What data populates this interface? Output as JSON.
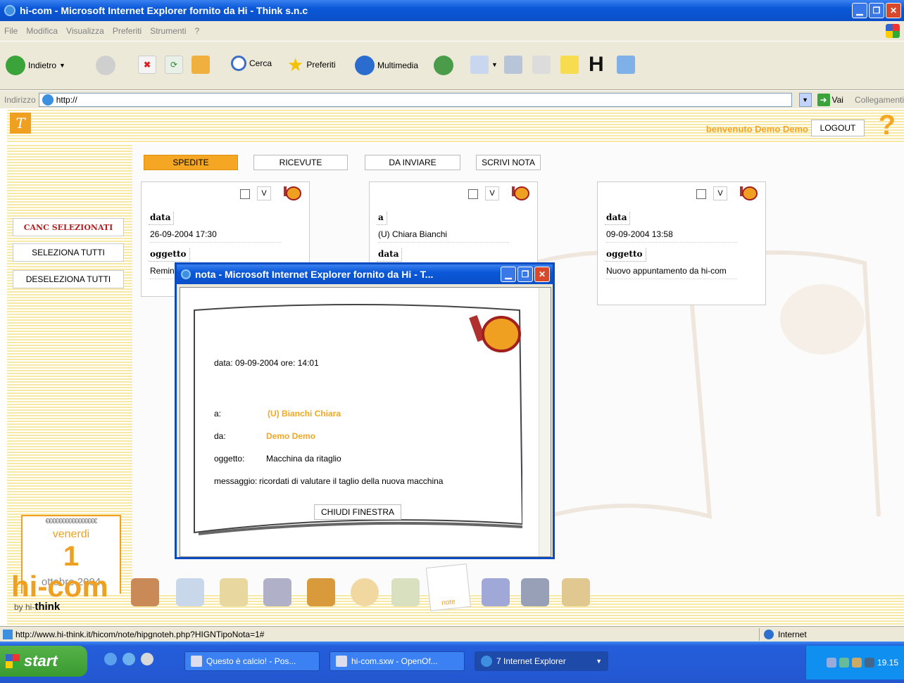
{
  "window": {
    "title": "hi-com - Microsoft Internet Explorer fornito da Hi - Think s.n.c"
  },
  "menu": [
    "File",
    "Modifica",
    "Visualizza",
    "Preferiti",
    "Strumenti",
    "?"
  ],
  "toolbar": {
    "back": "Indietro",
    "search": "Cerca",
    "favorites": "Preferiti",
    "media": "Multimedia"
  },
  "address": {
    "label": "Indirizzo",
    "value": "http://",
    "go": "Vai",
    "links": "Collegamenti"
  },
  "header": {
    "welcome": "benvenuto Demo Demo",
    "logout": "LOGOUT"
  },
  "side": {
    "canc": "CANC SELEZIONATI",
    "select_all": "SELEZIONA TUTTI",
    "deselect_all": "DESELEZIONA TUTTI"
  },
  "calendar": {
    "rings": "€€€€€€€€€€€€€€€€",
    "weekday": "venerdi",
    "day": "1",
    "month": "ottobre 2004"
  },
  "tabs": [
    "SPEDITE",
    "RICEVUTE",
    "DA INVIARE",
    "SCRIVI NOTA"
  ],
  "cards": [
    {
      "v": "V",
      "label1": "data",
      "value1": "26-09-2004    17:30",
      "label2": "oggetto",
      "value2": "Remin"
    },
    {
      "v": "V",
      "label1": "a",
      "value1": "(U) Chiara Bianchi",
      "label2": "data"
    },
    {
      "v": "V",
      "label1": "data",
      "value1": "09-09-2004    13:58",
      "label2": "oggetto",
      "value2": "Nuovo appuntamento da hi-com"
    }
  ],
  "popup": {
    "title": "nota - Microsoft Internet Explorer fornito da Hi - T...",
    "date_line": "data: 09-09-2004    ore: 14:01",
    "a_label": "a:",
    "a_value": "(U)  Bianchi Chiara",
    "da_label": "da:",
    "da_value": "Demo Demo",
    "oggetto_label": "oggetto:",
    "oggetto_value": "Macchina da ritaglio",
    "messaggio_label": "messaggio:",
    "messaggio_value": "ricordati di valutare il taglio della nuova macchina",
    "close": "CHIUDI FINESTRA"
  },
  "footer": {
    "logo": "hi-com",
    "by": "by hi-",
    "by_bold": "think",
    "note_label": "note"
  },
  "status": {
    "url": "http://www.hi-think.it/hicom/note/hipgnoteh.php?HIGNTipoNota=1#",
    "zone": "Internet"
  },
  "taskbar": {
    "start": "start",
    "tasks": [
      "Questo è calcio! - Pos...",
      "hi-com.sxw - OpenOf...",
      "7 Internet Explorer"
    ],
    "time": "19.15"
  },
  "colors": {
    "accent": "#f5a623",
    "title_blue": "#0a58d8",
    "stripe": "#f7e8a4"
  }
}
